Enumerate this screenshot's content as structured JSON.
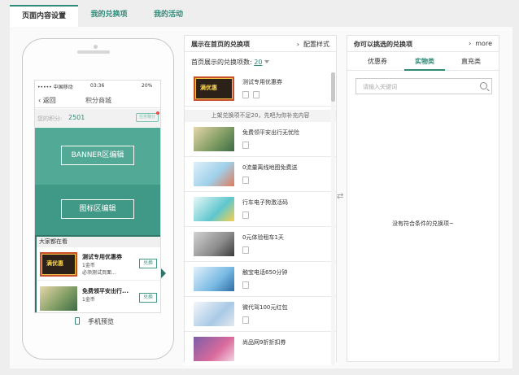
{
  "tabs": [
    {
      "label": "页面内容设置",
      "active": true
    },
    {
      "label": "我的兑换项",
      "active": false
    },
    {
      "label": "我的活动",
      "active": false
    }
  ],
  "phone": {
    "status_carrier": "••••• 中国移动",
    "status_time": "03:36",
    "status_battery": "20%",
    "back_label": "返回",
    "title": "积分商城",
    "points_label": "您的积分:",
    "points_value": "2501",
    "task_label": "任务赚分",
    "banner_edit": "BANNER区编辑",
    "icon_edit": "图标区编辑",
    "hot_title": "大家都在看",
    "hot_items": [
      {
        "name": "测试专用优惠券",
        "cost": "1金币",
        "note": "必须测试页面...",
        "btn": "兑换"
      },
      {
        "name": "免费领平安出行...",
        "cost": "1金币",
        "note": "",
        "btn": "兑换"
      }
    ],
    "preview_label": "手机预览"
  },
  "middle": {
    "title": "展示在首页的兑换项",
    "action": "配置样式",
    "count_label": "首页展示的兑换项数:",
    "count_value": "20",
    "warning": "上架兑换项不足20，先吧为你补充内容",
    "items": [
      {
        "name": "测试专用优惠券",
        "thumb": "promo"
      },
      {
        "name": "免费领平安出行无忧险",
        "thumb": "photo1"
      },
      {
        "name": "0流量离线地图免费送",
        "thumb": "photo2"
      },
      {
        "name": "行车电子狗激活码",
        "thumb": "photo3"
      },
      {
        "name": "0元体验租车1天",
        "thumb": "photo4"
      },
      {
        "name": "触宝电话650分钟",
        "thumb": "photo5"
      },
      {
        "name": "微代驾100元红包",
        "thumb": "photo6"
      },
      {
        "name": "尚品网9折折扣券",
        "thumb": "photo7"
      }
    ]
  },
  "right": {
    "title": "你可以挑选的兑换项",
    "more": "more",
    "tabs": [
      "优惠券",
      "实物类",
      "直充类"
    ],
    "active_tab": 1,
    "search_placeholder": "请输入关键词",
    "empty_text": "没有符合条件的兑换项~"
  },
  "colors": {
    "accent": "#2f8a78",
    "banner": "#52a996",
    "icon_area": "#3f9986"
  }
}
